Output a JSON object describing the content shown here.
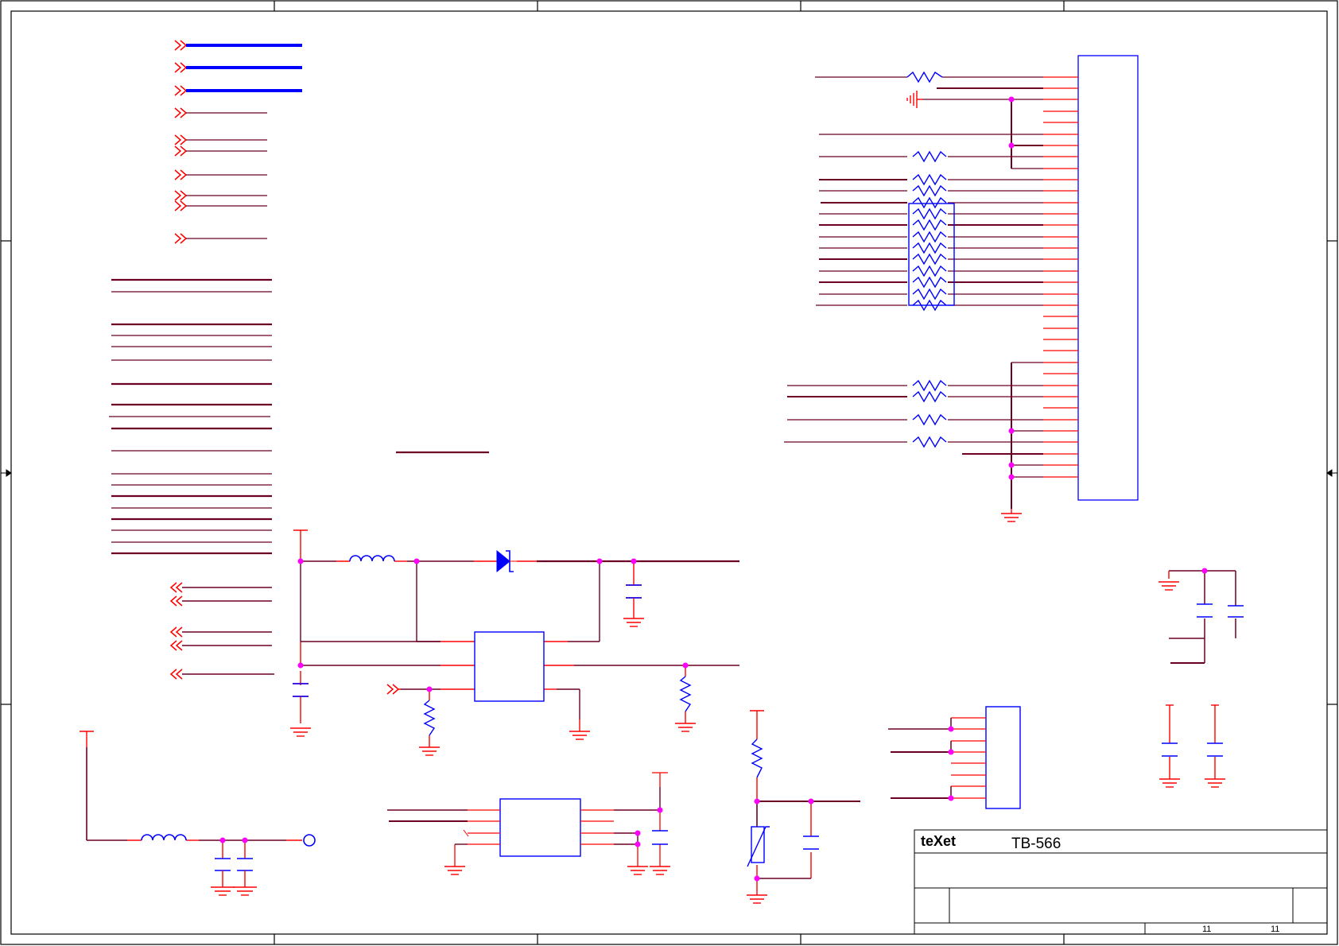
{
  "title_block": {
    "brand": "teXet",
    "model": "TB-566",
    "sheet_number": "11",
    "sheet_total": "11"
  },
  "colors": {
    "frame": "#000000",
    "wire": "#6b0024",
    "pin": "#ff0000",
    "bus": "#0000ff",
    "component": "#0000ff",
    "junction": "#ff00ff",
    "brand_accent": "#ff0000"
  }
}
